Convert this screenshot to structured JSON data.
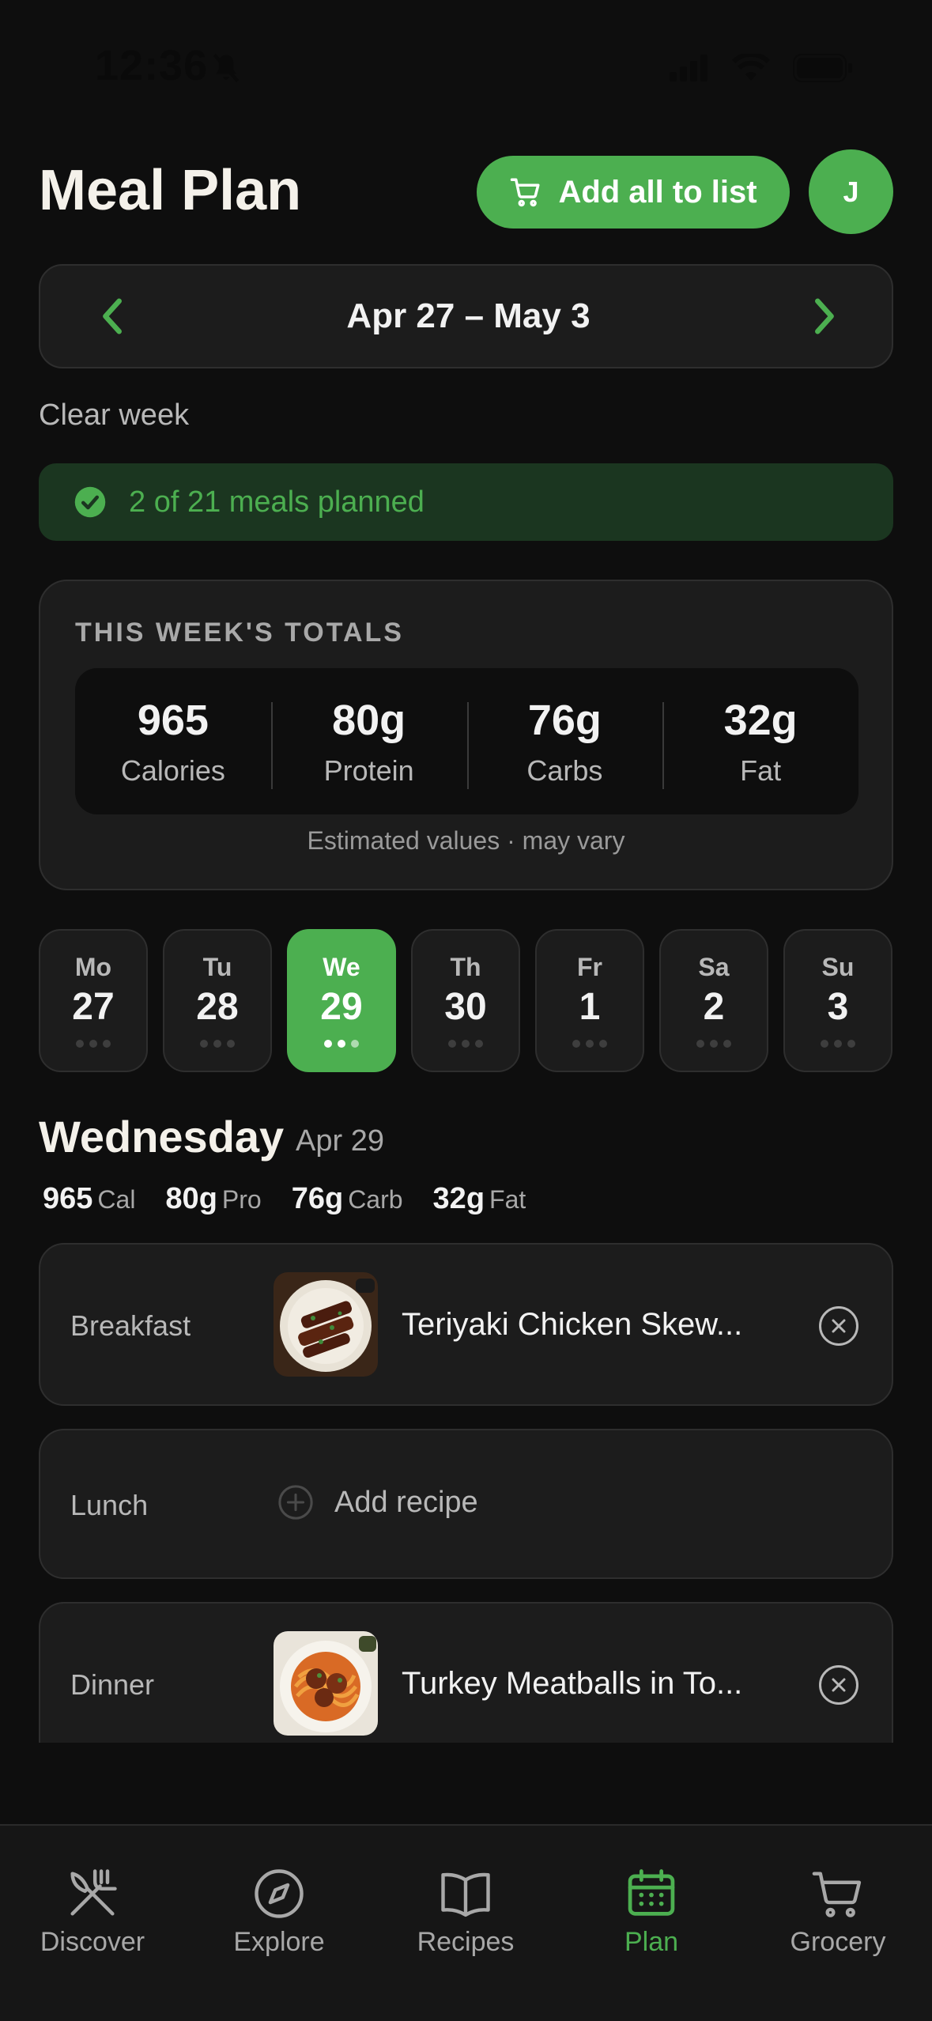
{
  "status_bar": {
    "time": "12:36"
  },
  "header": {
    "title": "Meal Plan",
    "add_all_label": "Add all to list",
    "avatar_initial": "J"
  },
  "week_nav": {
    "range": "Apr 27 – May 3"
  },
  "clear_week_label": "Clear week",
  "planned_banner": {
    "text": "2 of 21 meals planned"
  },
  "totals": {
    "heading": "THIS WEEK'S TOTALS",
    "items": [
      {
        "value": "965",
        "label": "Calories"
      },
      {
        "value": "80g",
        "label": "Protein"
      },
      {
        "value": "76g",
        "label": "Carbs"
      },
      {
        "value": "32g",
        "label": "Fat"
      }
    ],
    "note": "Estimated values · may vary"
  },
  "days": [
    {
      "abbr": "Mo",
      "num": "27",
      "planned": 0,
      "active": false
    },
    {
      "abbr": "Tu",
      "num": "28",
      "planned": 0,
      "active": false
    },
    {
      "abbr": "We",
      "num": "29",
      "planned": 2,
      "active": true
    },
    {
      "abbr": "Th",
      "num": "30",
      "planned": 0,
      "active": false
    },
    {
      "abbr": "Fr",
      "num": "1",
      "planned": 0,
      "active": false
    },
    {
      "abbr": "Sa",
      "num": "2",
      "planned": 0,
      "active": false
    },
    {
      "abbr": "Su",
      "num": "3",
      "planned": 0,
      "active": false
    }
  ],
  "selected_day": {
    "title": "Wednesday",
    "date": "Apr 29",
    "macros": [
      {
        "value": "965",
        "label": "Cal"
      },
      {
        "value": "80g",
        "label": "Pro"
      },
      {
        "value": "76g",
        "label": "Carb"
      },
      {
        "value": "32g",
        "label": "Fat"
      }
    ]
  },
  "meals": [
    {
      "slot": "Breakfast",
      "recipe": "Teriyaki Chicken Skew...",
      "image": "teriyaki-chicken-skewers-photo"
    },
    {
      "slot": "Lunch",
      "add_label": "Add recipe"
    },
    {
      "slot": "Dinner",
      "recipe": "Turkey Meatballs in To...",
      "image": "turkey-meatballs-spaghetti-photo"
    }
  ],
  "tabs": [
    {
      "label": "Discover",
      "icon": "fork-knife-icon",
      "active": false
    },
    {
      "label": "Explore",
      "icon": "compass-icon",
      "active": false
    },
    {
      "label": "Recipes",
      "icon": "book-icon",
      "active": false
    },
    {
      "label": "Plan",
      "icon": "calendar-icon",
      "active": true
    },
    {
      "label": "Grocery",
      "icon": "cart-icon",
      "active": false
    }
  ],
  "colors": {
    "accent": "#4caf50",
    "background": "#0e0e0e",
    "card": "#1c1c1c"
  }
}
